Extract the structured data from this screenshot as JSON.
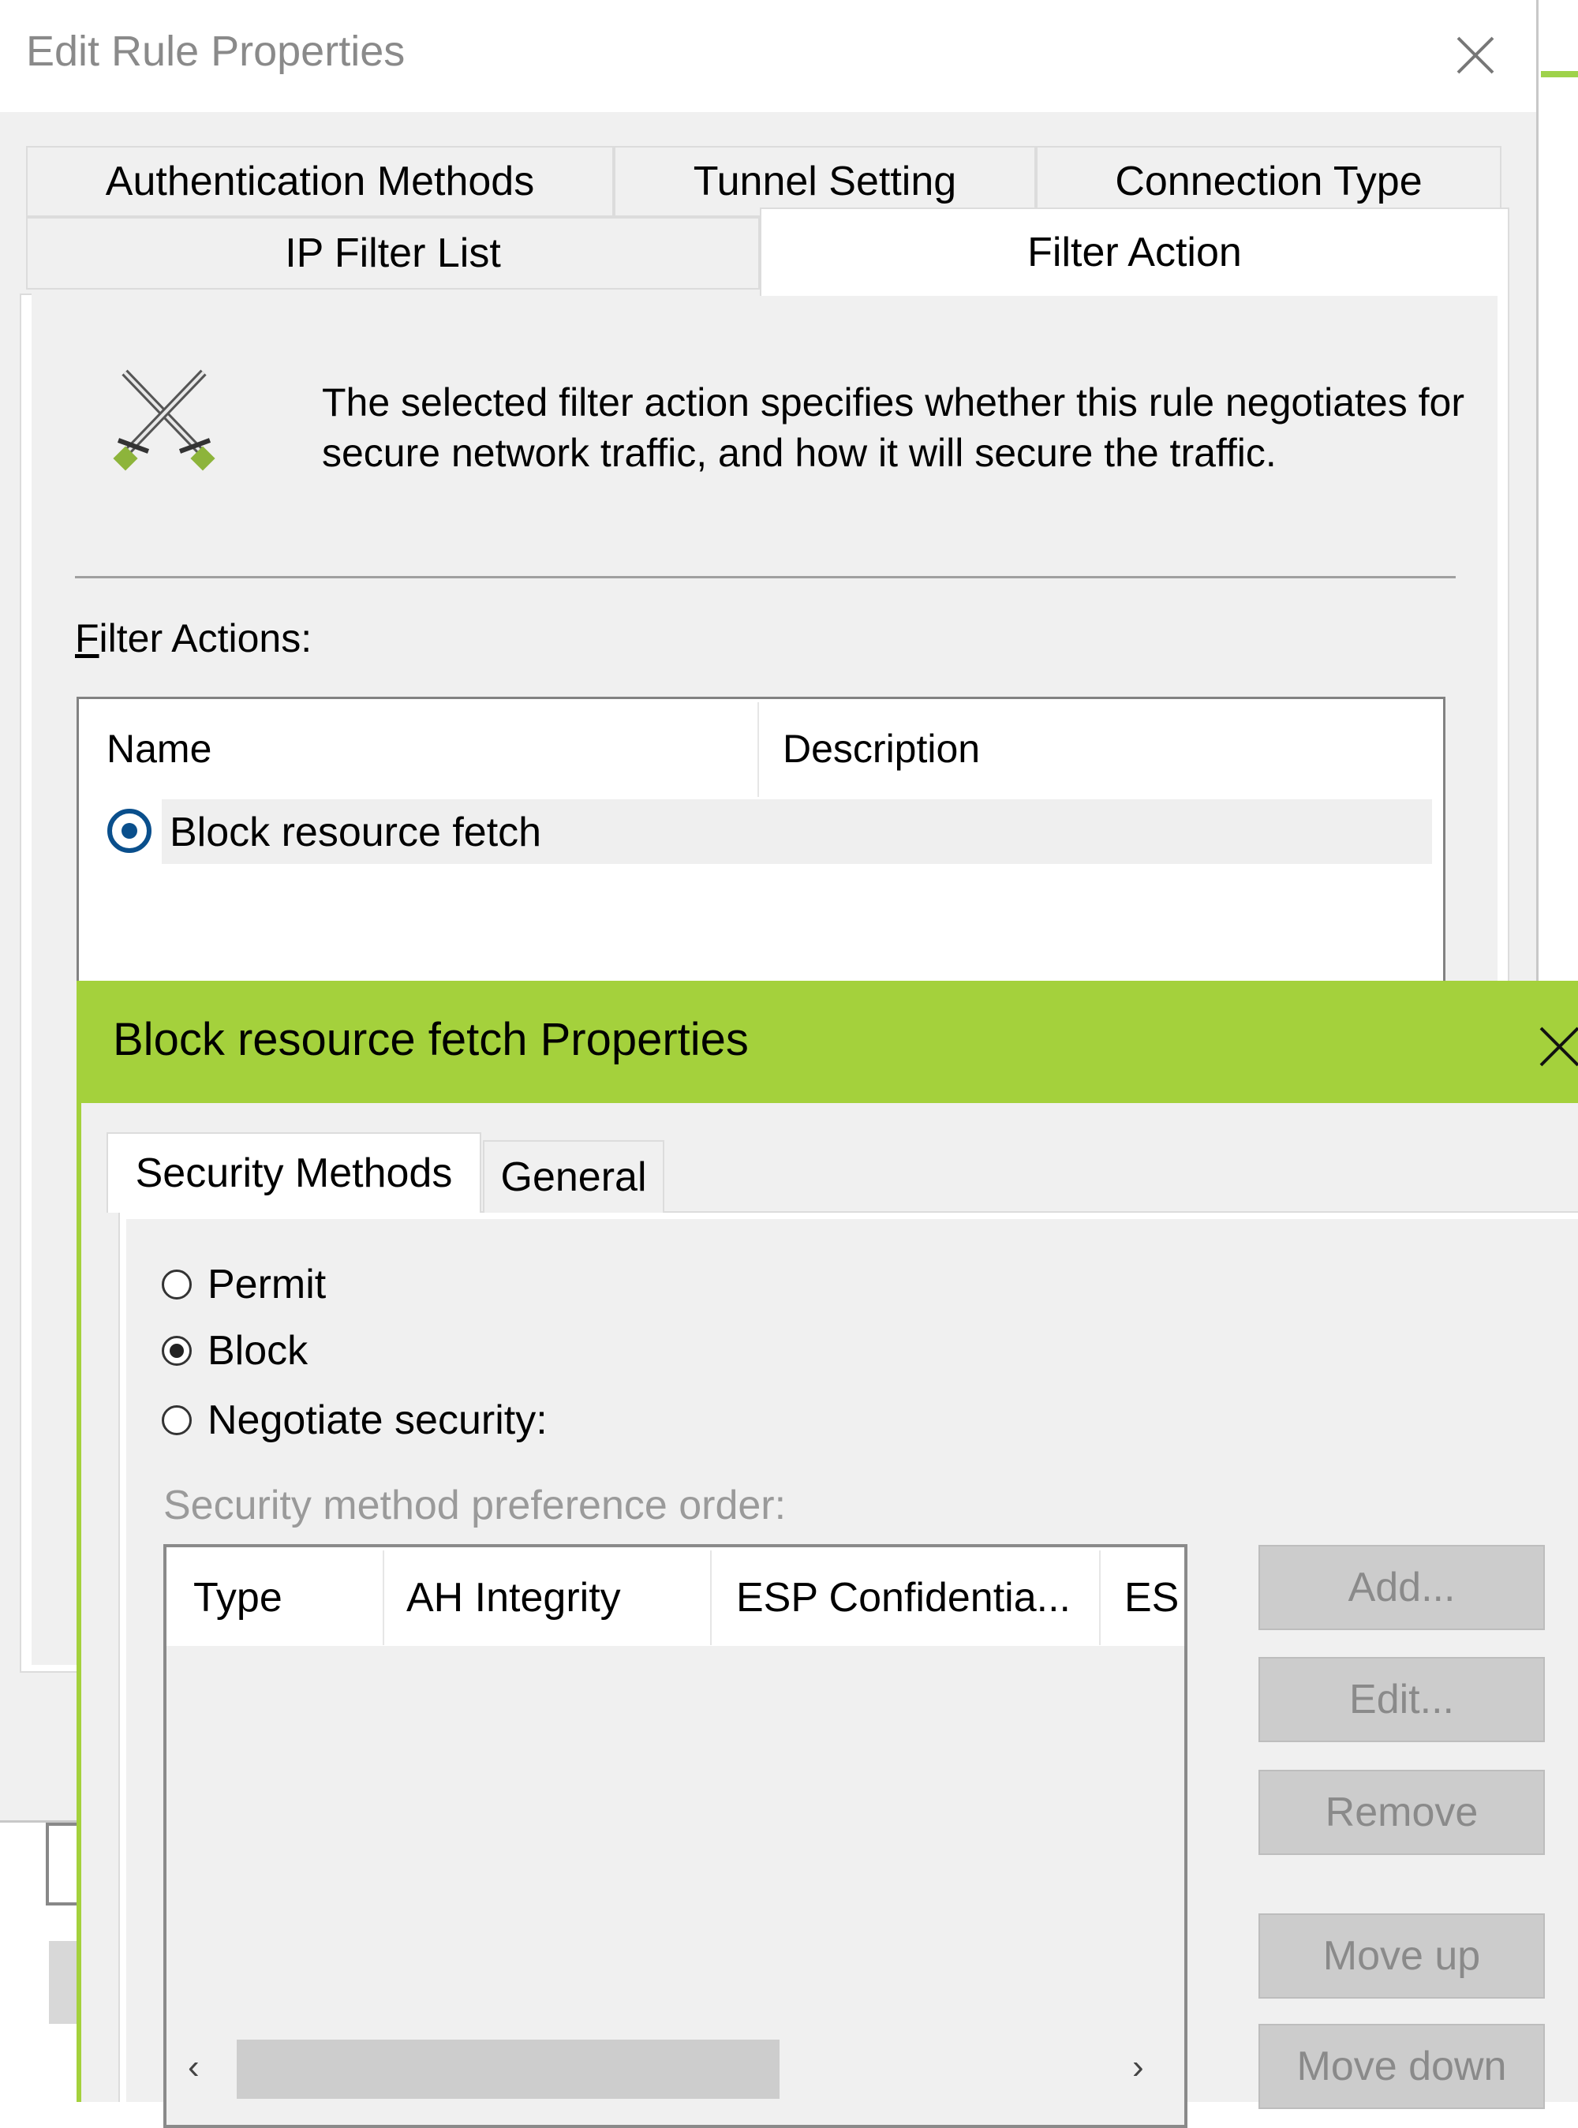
{
  "outer_dialog": {
    "title": "Edit Rule Properties",
    "close_icon": "close-icon",
    "tabs": [
      {
        "label": "Authentication Methods",
        "selected": false
      },
      {
        "label": "Tunnel Setting",
        "selected": false
      },
      {
        "label": "Connection Type",
        "selected": false
      },
      {
        "label": "IP Filter List",
        "selected": false
      },
      {
        "label": "Filter Action",
        "selected": true
      }
    ],
    "icon": "crossed-swords-icon",
    "description": "The selected filter action specifies whether this rule negotiates for secure network traffic, and how it will secure the traffic.",
    "filter_actions_label_hotkey": "F",
    "filter_actions_label_rest": "ilter Actions:",
    "list": {
      "columns": [
        "Name",
        "Description"
      ],
      "rows": [
        {
          "name": "Block resource fetch",
          "description": "",
          "selected": true
        }
      ]
    }
  },
  "inner_dialog": {
    "title": "Block resource fetch Properties",
    "accent_color": "#a4d13c",
    "tabs": [
      {
        "label": "Security Methods",
        "selected": true
      },
      {
        "label": "General",
        "selected": false
      }
    ],
    "radios": [
      {
        "label": "Permit",
        "checked": false
      },
      {
        "label": "Block",
        "checked": true
      },
      {
        "label": "Negotiate security:",
        "checked": false
      }
    ],
    "preference_label": "Security method preference order:",
    "methods_table": {
      "columns": [
        "Type",
        "AH Integrity",
        "ESP Confidentia...",
        "ES"
      ],
      "rows": []
    },
    "buttons": {
      "add": "Add...",
      "edit": "Edit...",
      "remove": "Remove",
      "move_up": "Move up",
      "move_down": "Move down"
    }
  }
}
